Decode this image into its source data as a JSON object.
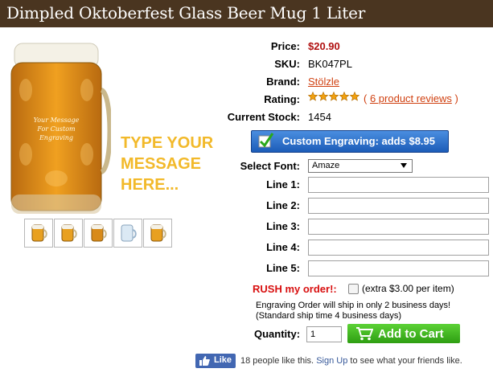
{
  "product": {
    "title": "Dimpled Oktoberfest Glass Beer Mug 1 Liter",
    "mug_engraving_lines": [
      "Your Message",
      "For Custom",
      "Engraving"
    ],
    "promo_lines": [
      "TYPE YOUR",
      "MESSAGE",
      "HERE..."
    ],
    "thumbnail_count": 5
  },
  "details": {
    "price_label": "Price:",
    "price_value": "$20.90",
    "sku_label": "SKU:",
    "sku_value": "BK047PL",
    "brand_label": "Brand:",
    "brand_value": "Stölzle",
    "rating_label": "Rating:",
    "rating_stars": 5,
    "reviews_open": "(",
    "reviews_link": "6 product reviews",
    "reviews_close": ")",
    "stock_label": "Current Stock:",
    "stock_value": "1454"
  },
  "engraving": {
    "button_label": "Custom Engraving: adds $8.95",
    "font_label": "Select Font:",
    "font_value": "Amaze",
    "lines": [
      {
        "label": "Line 1:",
        "value": ""
      },
      {
        "label": "Line 2:",
        "value": ""
      },
      {
        "label": "Line 3:",
        "value": ""
      },
      {
        "label": "Line 4:",
        "value": ""
      },
      {
        "label": "Line 5:",
        "value": ""
      }
    ]
  },
  "rush": {
    "label": "RUSH my order!:",
    "extra": "(extra $3.00 per item)",
    "ship_line1": "Engraving Order will ship in only 2 business days!",
    "ship_line2": "(Standard ship time 4 business days)"
  },
  "cart": {
    "quantity_label": "Quantity:",
    "quantity_value": "1",
    "add_button": "Add to Cart"
  },
  "social": {
    "like_button": "Like",
    "text_prefix": "18 people like this.",
    "signup_link": "Sign Up",
    "text_suffix": "to see what your friends like."
  },
  "colors": {
    "title_bar": "#4a3520",
    "price": "#b01010",
    "link": "#d04010",
    "promo": "#f2b92a",
    "engrave_button": "#2a6fd0",
    "cart_button": "#3cb41c",
    "rush": "#d81010",
    "facebook": "#4267b2"
  }
}
